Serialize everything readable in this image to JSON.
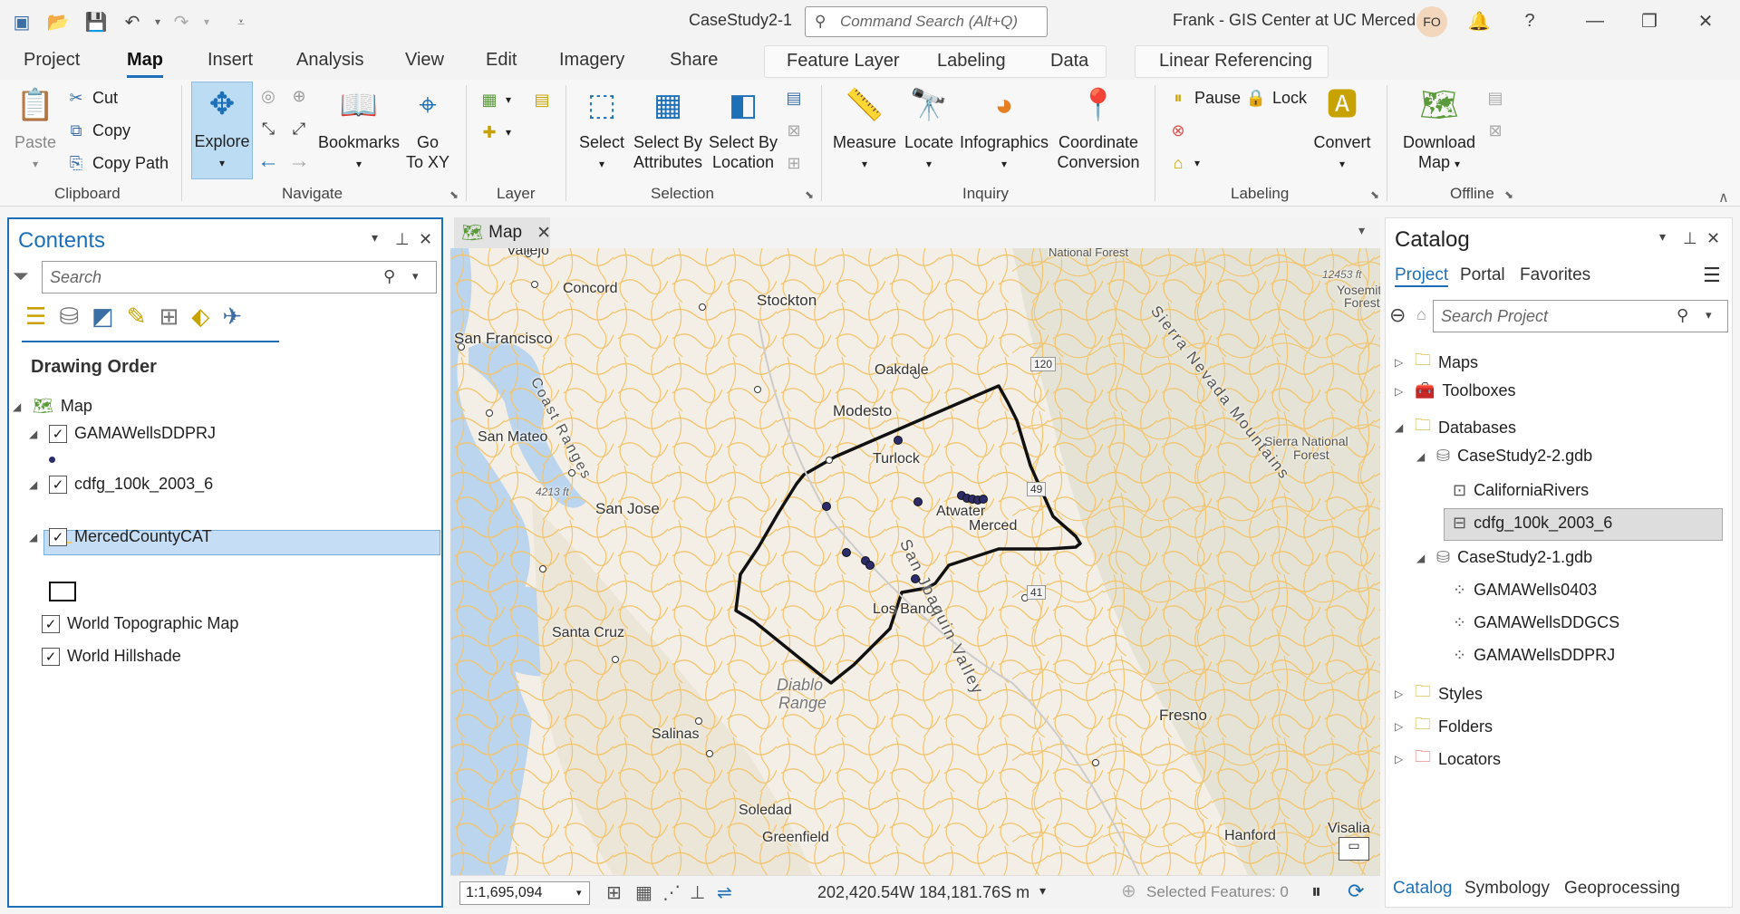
{
  "titlebar": {
    "document_title": "CaseStudy2-1",
    "command_search_placeholder": "Command Search (Alt+Q)",
    "user": "Frank - GIS Center at UC Merced",
    "avatar_initials": "FO"
  },
  "ribbon_tabs": [
    "Project",
    "Map",
    "Insert",
    "Analysis",
    "View",
    "Edit",
    "Imagery",
    "Share"
  ],
  "active_tab": "Map",
  "contextual_tabs": {
    "feature_layer": [
      "Feature Layer",
      "Labeling",
      "Data"
    ],
    "linear_referencing": "Linear Referencing"
  },
  "ribbon": {
    "clipboard": {
      "label": "Clipboard",
      "paste": "Paste",
      "cut": "Cut",
      "copy": "Copy",
      "copy_path": "Copy Path"
    },
    "navigate": {
      "label": "Navigate",
      "explore": "Explore",
      "bookmarks": "Bookmarks",
      "goto_line1": "Go",
      "goto_line2": "To XY"
    },
    "layer": {
      "label": "Layer"
    },
    "selection": {
      "label": "Selection",
      "select": "Select",
      "by_attr_line1": "Select By",
      "by_attr_line2": "Attributes",
      "by_loc_line1": "Select By",
      "by_loc_line2": "Location"
    },
    "inquiry": {
      "label": "Inquiry",
      "measure": "Measure",
      "locate": "Locate",
      "infographics": "Infographics",
      "coord_line1": "Coordinate",
      "coord_line2": "Conversion"
    },
    "labeling": {
      "label": "Labeling",
      "pause": "Pause",
      "lock": "Lock",
      "convert": "Convert"
    },
    "offline": {
      "label": "Offline",
      "download_line1": "Download",
      "download_line2": "Map"
    }
  },
  "contents": {
    "title": "Contents",
    "search_placeholder": "Search",
    "drawing_order": "Drawing Order",
    "map_name": "Map",
    "layers": [
      "GAMAWellsDDPRJ",
      "cdfg_100k_2003_6",
      "MercedCountyCAT",
      "World Topographic Map",
      "World Hillshade"
    ]
  },
  "map_view": {
    "tab_label": "Map",
    "places": [
      {
        "name": "Vallejo"
      },
      {
        "name": "Concord"
      },
      {
        "name": "Stockton"
      },
      {
        "name": "San Francisco"
      },
      {
        "name": "Oakdale"
      },
      {
        "name": "Modesto"
      },
      {
        "name": "San Mateo"
      },
      {
        "name": "Turlock"
      },
      {
        "name": "San Jose"
      },
      {
        "name": "Atwater"
      },
      {
        "name": "Merced"
      },
      {
        "name": "Los Banos"
      },
      {
        "name": "Santa Cruz"
      },
      {
        "name": "Fresno"
      },
      {
        "name": "Salinas"
      },
      {
        "name": "Soledad"
      },
      {
        "name": "Greenfield"
      },
      {
        "name": "Hanford"
      },
      {
        "name": "Visalia"
      }
    ],
    "region_labels": {
      "coast_ranges": "Coast Ranges",
      "san_joaquin_valley": "San Joaquin Valley",
      "sierra_nevada": "Sierra Nevada Mountains",
      "sierra_national_forest_1": "Sierra National",
      "sierra_national_forest_2": "Forest",
      "national_forest": "National Forest",
      "yosemite_1": "Yosemite",
      "yosemite_2": "Forest",
      "diablo_range_1": "Diablo",
      "diablo_range_2": "Range",
      "elevation_1": "12453 ft",
      "elevation_2": "4213 ft",
      "hwy_120": "120",
      "hwy_49": "49",
      "hwy_41": "41"
    },
    "scale": "1:1,695,094",
    "coordinates": "202,420.54W 184,181.76S m",
    "selected_features": "Selected Features: 0"
  },
  "catalog": {
    "title": "Catalog",
    "tabs": [
      "Project",
      "Portal",
      "Favorites"
    ],
    "active_tab": "Project",
    "search_placeholder": "Search Project",
    "items": {
      "maps": "Maps",
      "toolboxes": "Toolboxes",
      "databases": "Databases",
      "gdb2": "CaseStudy2-2.gdb",
      "california_rivers": "CaliforniaRivers",
      "cdfg": "cdfg_100k_2003_6",
      "gdb1": "CaseStudy2-1.gdb",
      "wells0403": "GAMAWells0403",
      "wellsddgcs": "GAMAWellsDDGCS",
      "wellsddprj": "GAMAWellsDDPRJ",
      "styles": "Styles",
      "folders": "Folders",
      "locators": "Locators"
    }
  },
  "bottom_tabs": [
    "Catalog",
    "Symbology",
    "Geoprocessing"
  ],
  "colors": {
    "accent": "#1d70b8",
    "rivers": "#f2c46d",
    "selected_row": "#c5ddf5",
    "well_symbol": "#2c2c6c"
  }
}
